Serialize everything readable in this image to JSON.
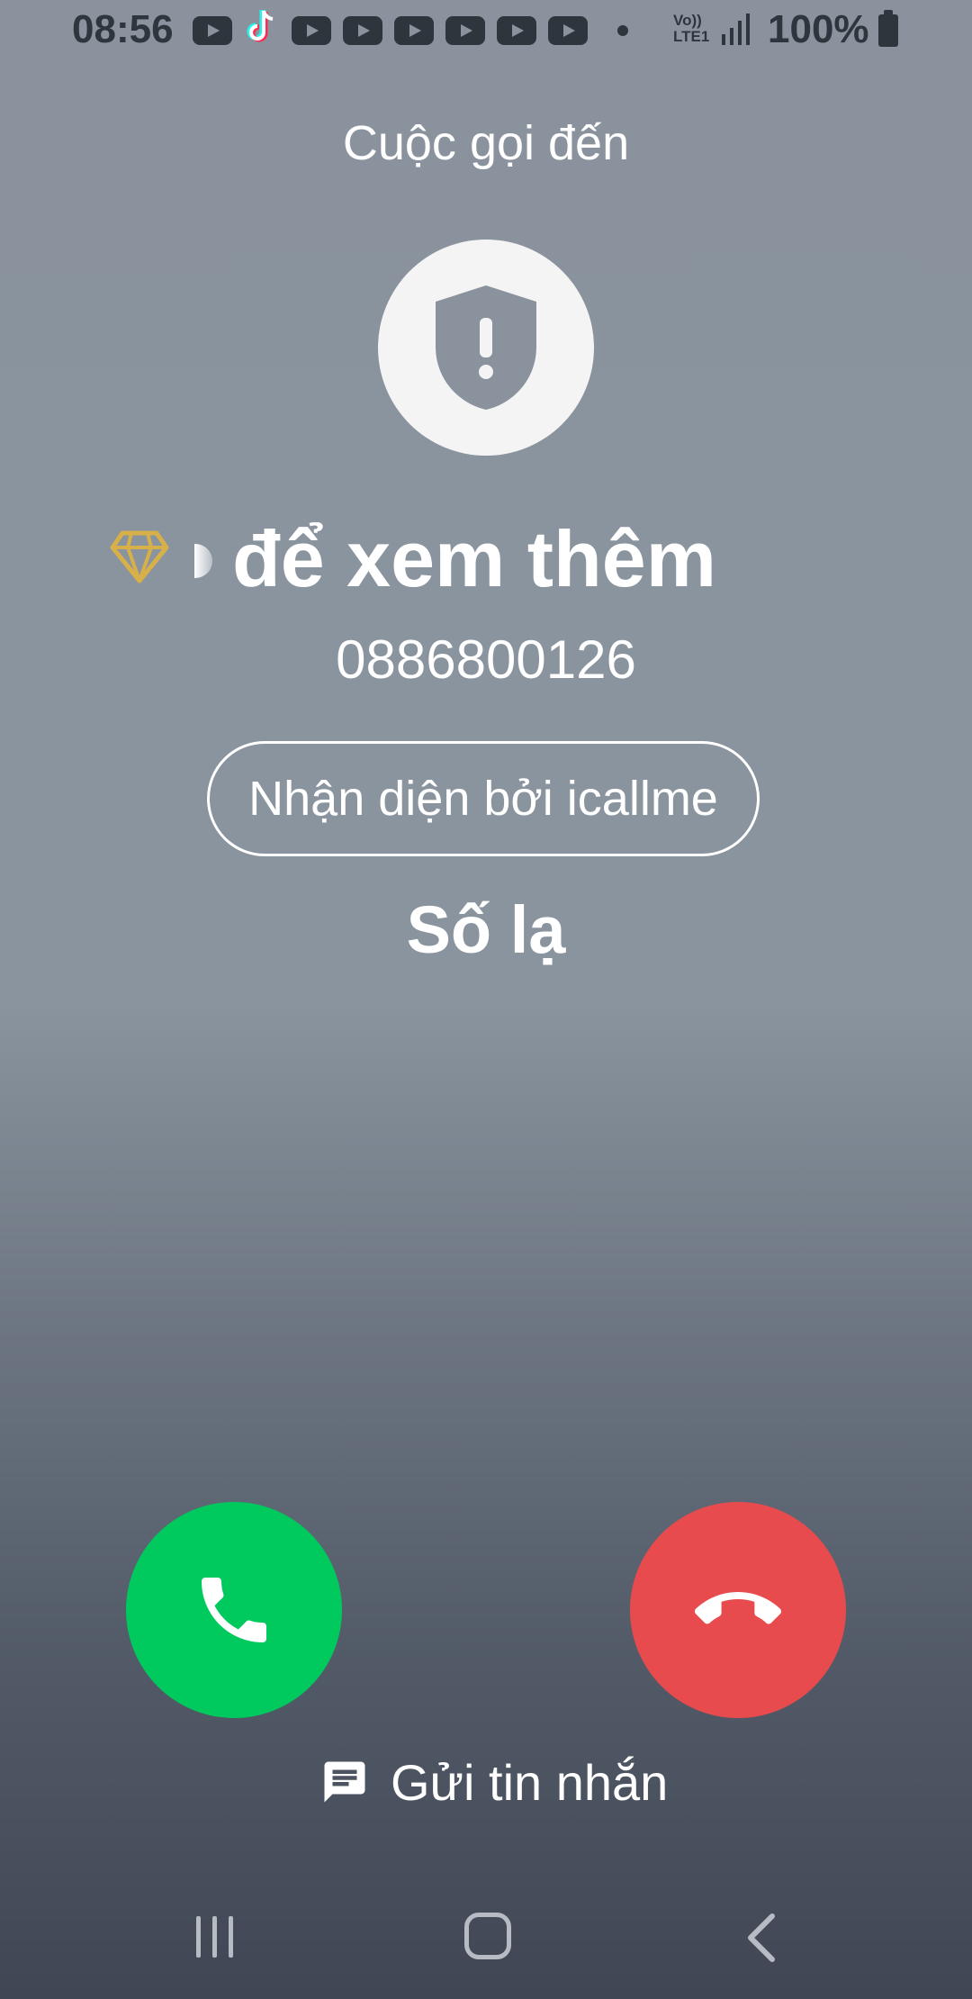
{
  "status_bar": {
    "time": "08:56",
    "notification_icons": [
      "youtube-icon",
      "tiktok-icon",
      "youtube-icon",
      "youtube-icon",
      "youtube-icon",
      "youtube-icon",
      "youtube-icon",
      "youtube-icon",
      "more-dot-icon"
    ],
    "network_top": "Vo))",
    "network_bottom": "LTE1",
    "battery": "100%"
  },
  "call": {
    "title": "Cuộc gọi đến",
    "caller_name": "để xem thêm",
    "phone_number": "0886800126",
    "identify_button": "Nhận diện bởi icallme",
    "caller_label": "Số lạ",
    "send_message_label": "Gửi tin nhắn"
  },
  "colors": {
    "accept": "#00c95d",
    "decline": "#e84b4d",
    "avatar_bg": "#f4f4f4",
    "gem": "#d7b04a"
  },
  "icons": {
    "avatar": "shield-alert-icon",
    "premium": "diamond-icon",
    "accept": "phone-icon",
    "decline": "hang-up-icon",
    "message": "message-icon",
    "nav": [
      "recent-apps-icon",
      "home-icon",
      "back-icon"
    ]
  }
}
